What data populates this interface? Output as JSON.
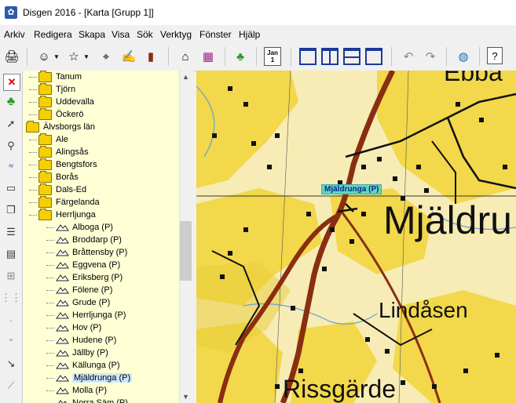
{
  "window": {
    "title": "Disgen 2016 - [Karta [Grupp 1]]"
  },
  "menu": [
    "Arkiv",
    "Redigera",
    "Skapa",
    "Visa",
    "Sök",
    "Verktyg",
    "Fönster",
    "Hjälp"
  ],
  "toolbar": {
    "icons": [
      "print-icon",
      "person-icon",
      "family-icon",
      "binoculars-icon",
      "notes-icon",
      "book-icon",
      "home-icon",
      "colored-books-icon",
      "map-icon",
      "calendar-icon",
      "layout-1-icon",
      "layout-2-icon",
      "layout-3-icon",
      "layout-4-icon",
      "undo-icon",
      "redo-icon",
      "globe-icon",
      "help-icon"
    ],
    "calendar_text": "Jan 1",
    "help_text": "?"
  },
  "tree": {
    "nodes": [
      {
        "label": "Tanum",
        "type": "folder",
        "level": 2
      },
      {
        "label": "Tjörn",
        "type": "folder",
        "level": 2
      },
      {
        "label": "Uddevalla",
        "type": "folder",
        "level": 2
      },
      {
        "label": "Öckerö",
        "type": "folder",
        "level": 2
      },
      {
        "label": "Älvsborgs län",
        "type": "folder",
        "level": 1
      },
      {
        "label": "Ale",
        "type": "folder",
        "level": 2
      },
      {
        "label": "Alingsås",
        "type": "folder",
        "level": 2
      },
      {
        "label": "Bengtsfors",
        "type": "folder",
        "level": 2
      },
      {
        "label": "Borås",
        "type": "folder",
        "level": 2
      },
      {
        "label": "Dals-Ed",
        "type": "folder",
        "level": 2
      },
      {
        "label": "Färgelanda",
        "type": "folder",
        "level": 2
      },
      {
        "label": "Herrljunga",
        "type": "folder",
        "level": 2
      },
      {
        "label": "Alboga (P)",
        "type": "parish",
        "level": 3
      },
      {
        "label": "Broddarp (P)",
        "type": "parish",
        "level": 3
      },
      {
        "label": "Bråttensby (P)",
        "type": "parish",
        "level": 3
      },
      {
        "label": "Eggvena (P)",
        "type": "parish",
        "level": 3
      },
      {
        "label": "Eriksberg (P)",
        "type": "parish",
        "level": 3
      },
      {
        "label": "Fölene (P)",
        "type": "parish",
        "level": 3
      },
      {
        "label": "Grude (P)",
        "type": "parish",
        "level": 3
      },
      {
        "label": "Herrljunga (P)",
        "type": "parish",
        "level": 3
      },
      {
        "label": "Hov (P)",
        "type": "parish",
        "level": 3
      },
      {
        "label": "Hudene (P)",
        "type": "parish",
        "level": 3
      },
      {
        "label": "Jällby (P)",
        "type": "parish",
        "level": 3
      },
      {
        "label": "Källunga (P)",
        "type": "parish",
        "level": 3
      },
      {
        "label": "Mjäldrunga (P)",
        "type": "parish",
        "level": 3,
        "selected": true
      },
      {
        "label": "Molla (P)",
        "type": "parish",
        "level": 3
      },
      {
        "label": "Norra Säm (P)",
        "type": "parish",
        "level": 3
      }
    ]
  },
  "map": {
    "labels": [
      "Ebba",
      "Mjäldru",
      "Lindåsen",
      "Rissgärde"
    ],
    "popup": "Mjäldrunga (P)"
  },
  "colors": {
    "map_yellow": "#f2d84a",
    "map_cream": "#f7ecb5",
    "road": "#8a2e12",
    "tree_bg": "#ffffd6",
    "selected": "#cce8ff"
  }
}
